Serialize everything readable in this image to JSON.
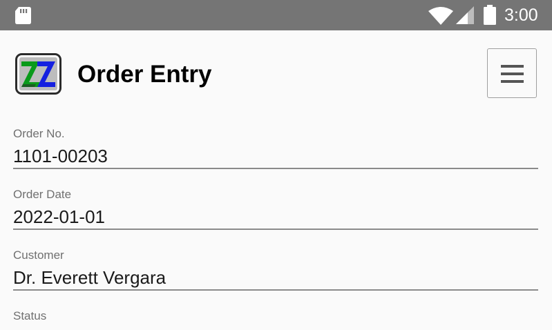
{
  "status_bar": {
    "time": "3:00",
    "icons": [
      "sd-card-icon",
      "wifi-icon",
      "signal-icon",
      "battery-icon"
    ],
    "background": "#757575"
  },
  "header": {
    "title": "Order Entry",
    "logo_icon": "app-logo-icon",
    "menu_icon": "hamburger-menu-icon"
  },
  "form": {
    "order_no": {
      "label": "Order No.",
      "value": "1101-00203"
    },
    "order_date": {
      "label": "Order Date",
      "value": "2022-01-01"
    },
    "customer": {
      "label": "Customer",
      "value": "Dr. Everett Vergara"
    },
    "status": {
      "label": "Status"
    }
  }
}
